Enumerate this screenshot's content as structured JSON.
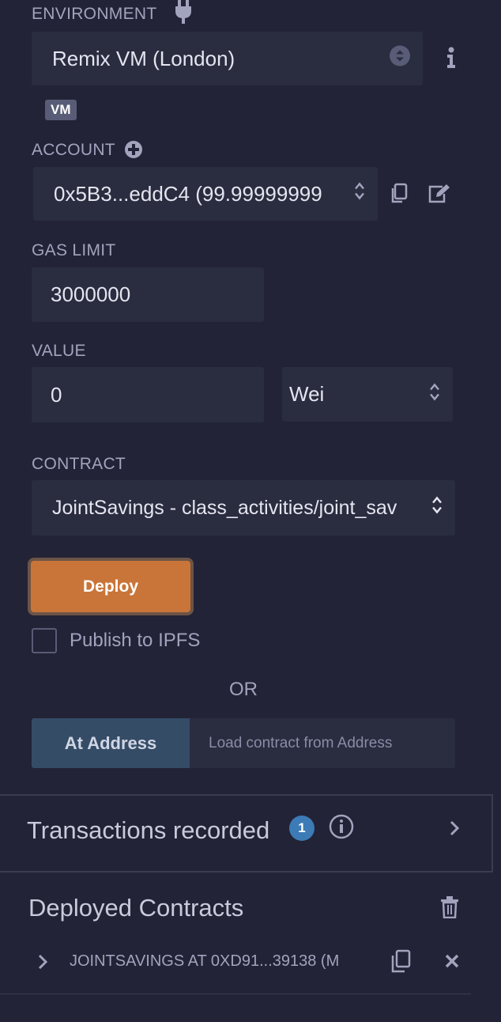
{
  "environment": {
    "label": "ENVIRONMENT",
    "value": "Remix VM (London)",
    "badge": "VM"
  },
  "account": {
    "label": "ACCOUNT",
    "value": "0x5B3...eddC4 (99.99999999"
  },
  "gas_limit": {
    "label": "GAS LIMIT",
    "value": "3000000"
  },
  "value": {
    "label": "VALUE",
    "amount": "0",
    "unit": "Wei"
  },
  "contract": {
    "label": "CONTRACT",
    "value": "JointSavings - class_activities/joint_sav"
  },
  "deploy": {
    "button_label": "Deploy",
    "publish_label": "Publish to IPFS"
  },
  "or_label": "OR",
  "at_address": {
    "button_label": "At Address",
    "placeholder": "Load contract from Address"
  },
  "transactions": {
    "title": "Transactions recorded",
    "count": "1"
  },
  "deployed": {
    "title": "Deployed Contracts",
    "items": [
      {
        "label": "JOINTSAVINGS AT 0XD91...39138 (M"
      }
    ]
  },
  "colors": {
    "background": "#222336",
    "field": "#2a2c3f",
    "deploy": "#c97539",
    "at_address": "#354c67",
    "badge": "#3c7bb6"
  }
}
